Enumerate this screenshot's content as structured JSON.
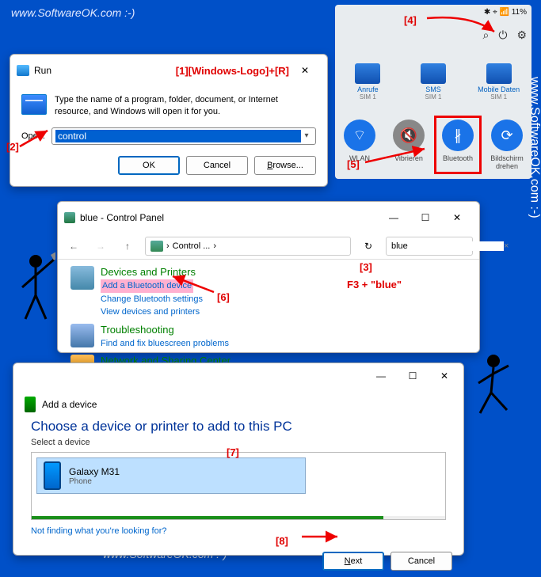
{
  "watermarks": {
    "top": "www.SoftwareOK.com :-)",
    "side": "www.SoftwareOK.com :-)"
  },
  "annotations": {
    "a1": "[1][Windows-Logo]+[R]",
    "a2": "[2]",
    "a3": "[3]",
    "a3b": "F3 + \"blue\"",
    "a4": "[4]",
    "a5": "[5]",
    "a6": "[6]",
    "a7": "[7]",
    "a8": "[8]"
  },
  "run": {
    "title": "Run",
    "desc": "Type the name of a program, folder, document, or Internet resource, and Windows will open it for you.",
    "open_label": "Open:",
    "value": "control",
    "ok": "OK",
    "cancel": "Cancel",
    "browse": "Browse..."
  },
  "phone": {
    "status": "✱ ⌖ 📶 11%",
    "icons": {
      "search": "⌕",
      "power": "⏻",
      "gear": "⚙"
    },
    "row1": [
      {
        "label": "Anrufe",
        "sub": "SIM 1"
      },
      {
        "label": "SMS",
        "sub": "SIM 1"
      },
      {
        "label": "Mobile Daten",
        "sub": "SIM 1"
      }
    ],
    "qs": [
      {
        "label": "WLAN",
        "glyph": "⌔",
        "cls": "blue"
      },
      {
        "label": "Vibrieren",
        "glyph": "🔇",
        "cls": "gray"
      },
      {
        "label": "Bluetooth",
        "glyph": "∦",
        "cls": "blue",
        "hl": true
      },
      {
        "label": "Bildschirm drehen",
        "glyph": "⟳",
        "cls": "blue"
      }
    ]
  },
  "ctrl": {
    "title": "blue - Control Panel",
    "breadcrumb": "Control ...",
    "search": "blue",
    "cat1": "Devices and Printers",
    "links1": [
      "Add a Bluetooth device",
      "Change Bluetooth settings",
      "View devices and printers"
    ],
    "cat2": "Troubleshooting",
    "links2": [
      "Find and fix bluescreen problems"
    ],
    "cat3": "Network and Sharing Center"
  },
  "add": {
    "win_title": "Add a device",
    "heading": "Choose a device or printer to add to this PC",
    "sub": "Select a device",
    "device_name": "Galaxy M31",
    "device_type": "Phone",
    "help": "Not finding what you're looking for?",
    "next": "Next",
    "cancel": "Cancel"
  }
}
